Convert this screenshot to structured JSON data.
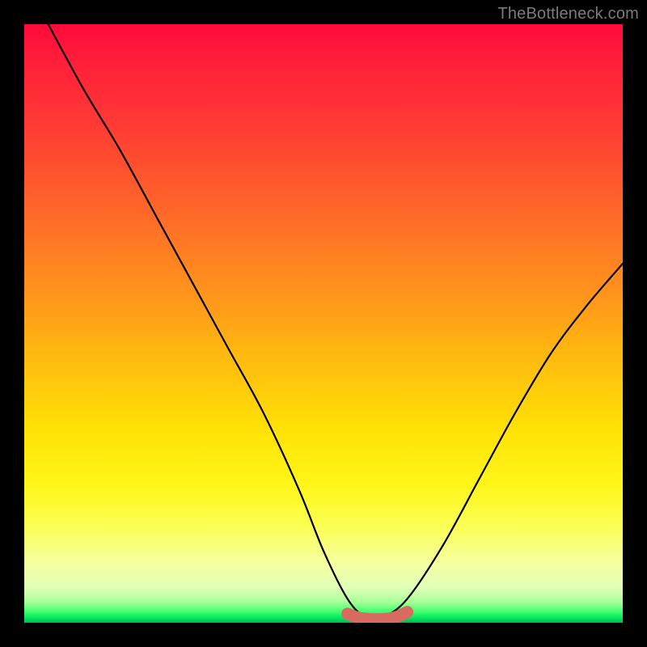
{
  "watermark": "TheBottleneck.com",
  "chart_data": {
    "type": "line",
    "title": "",
    "xlabel": "",
    "ylabel": "",
    "xlim": [
      0,
      100
    ],
    "ylim": [
      0,
      100
    ],
    "grid": false,
    "legend": false,
    "series": [
      {
        "name": "bottleneck-curve",
        "color": "#000000",
        "x": [
          4,
          10,
          16,
          22,
          28,
          34,
          40,
          46,
          50,
          54,
          57,
          60,
          64,
          70,
          76,
          82,
          88,
          94,
          100
        ],
        "y": [
          100,
          89,
          79,
          68,
          57,
          46,
          35,
          22,
          12,
          4,
          1,
          1,
          4,
          13,
          24,
          35,
          45,
          53,
          60
        ]
      },
      {
        "name": "bottom-marker",
        "color": "#d86a60",
        "x": [
          54,
          56,
          58,
          60,
          62,
          64
        ],
        "y": [
          1.5,
          0.8,
          0.6,
          0.6,
          0.9,
          1.8
        ]
      }
    ],
    "gradient_stops": [
      {
        "pos": 0,
        "color": "#ff0a3a"
      },
      {
        "pos": 17,
        "color": "#ff3b34"
      },
      {
        "pos": 45,
        "color": "#ff941c"
      },
      {
        "pos": 68,
        "color": "#ffe205"
      },
      {
        "pos": 90,
        "color": "#f6ffa0"
      },
      {
        "pos": 98,
        "color": "#3dff6c"
      },
      {
        "pos": 100,
        "color": "#00b84e"
      }
    ]
  }
}
